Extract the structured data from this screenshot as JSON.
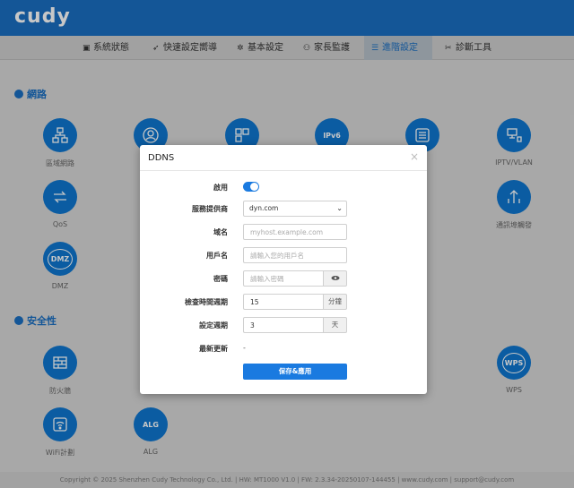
{
  "brand": "cudy",
  "nav": [
    {
      "label": "系統狀態",
      "icon": "monitor-icon",
      "glyph": "▣"
    },
    {
      "label": "快速設定嚮導",
      "icon": "rocket-icon",
      "glyph": "➶"
    },
    {
      "label": "基本設定",
      "icon": "gear-icon",
      "glyph": "✲"
    },
    {
      "label": "家長監護",
      "icon": "users-icon",
      "glyph": "⚇"
    },
    {
      "label": "進階設定",
      "icon": "sliders-icon",
      "glyph": "☰"
    },
    {
      "label": "診斷工具",
      "icon": "wrench-icon",
      "glyph": "✂"
    }
  ],
  "sections": {
    "network": "網路",
    "security": "安全性"
  },
  "tiles": {
    "lan": "區域網路",
    "iptv": "IPTV/VLAN",
    "qos": "QoS",
    "port_forward": "通訊埠觸發",
    "dmz": "DMZ",
    "firewall": "防火牆",
    "wps": "WPS",
    "wifi_schedule": "WiFi計劃",
    "alg": "ALG",
    "dmz_abbr": "DMZ",
    "alg_abbr": "ALG",
    "wps_abbr": "WPS",
    "ipv6_abbr": "IPv6"
  },
  "footer": "Copyright © 2025 Shenzhen Cudy Technology Co., Ltd. | HW: MT1000 V1.0 | FW: 2.3.34-20250107-144455 | www.cudy.com | support@cudy.com",
  "modal": {
    "title": "DDNS",
    "close": "×",
    "enable_label": "啟用",
    "provider_label": "服務提供商",
    "provider_value": "dyn.com",
    "domain_label": "域名",
    "domain_placeholder": "myhost.example.com",
    "user_label": "用戶名",
    "user_placeholder": "請輸入您的用戶名",
    "password_label": "密碼",
    "password_placeholder": "請輸入密碼",
    "check_label": "檢查時間週期",
    "check_value": "15",
    "check_unit": "分鐘",
    "force_label": "設定週期",
    "force_value": "3",
    "force_unit": "天",
    "last_update_label": "最新更新",
    "last_update_value": "-",
    "save": "保存&應用"
  },
  "colors": {
    "brand": "#1a6fc2",
    "accent": "#1a7ae0"
  }
}
